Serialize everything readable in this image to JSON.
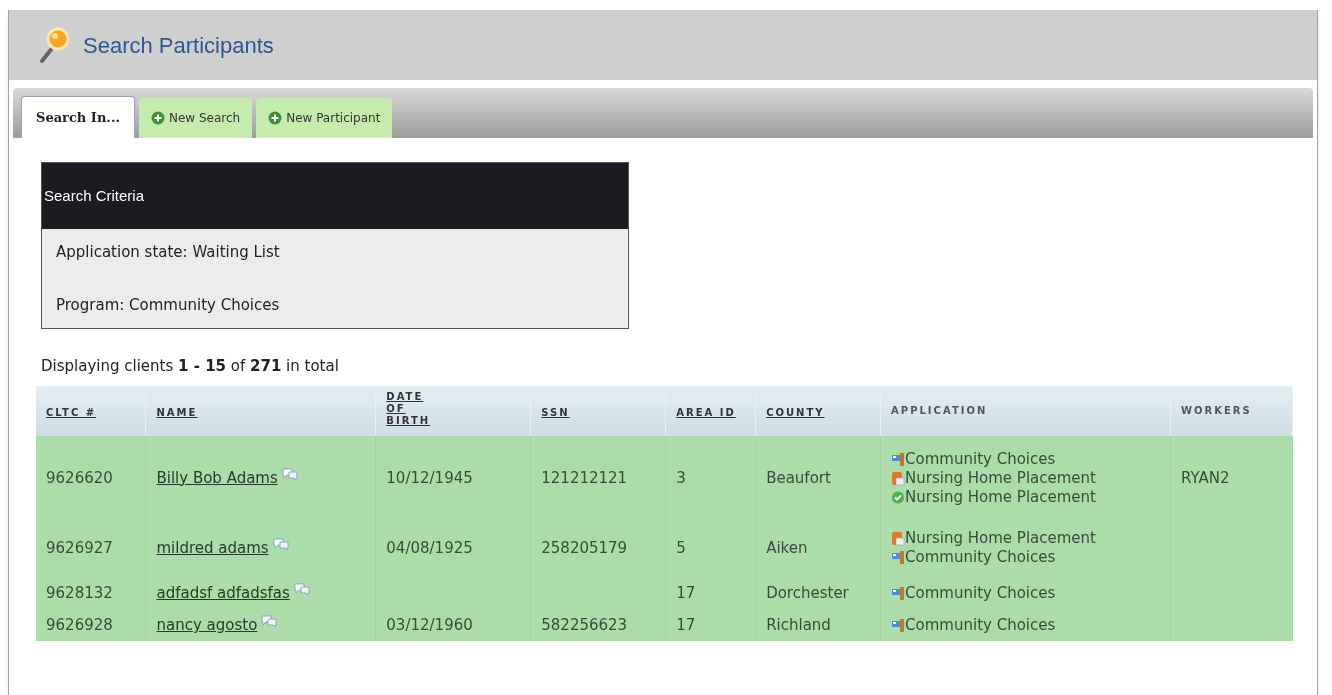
{
  "header": {
    "title": "Search Participants"
  },
  "tabs": [
    {
      "label": "Search In...",
      "kind": "plain",
      "selected": true
    },
    {
      "label": "New Search",
      "kind": "add",
      "selected": false
    },
    {
      "label": "New Participant",
      "kind": "add",
      "selected": false
    }
  ],
  "search_criteria": {
    "title": "Search Criteria",
    "lines": [
      "Application state: Waiting List",
      "Program: Community Choices"
    ]
  },
  "summary": "Displaying clients **1 - 15** of **271** in total",
  "table": {
    "columns": [
      {
        "label": "CLTC #",
        "sortable": true
      },
      {
        "label": "NAME",
        "sortable": true
      },
      {
        "label": "DATE OF BIRTH",
        "sortable": true
      },
      {
        "label": "SSN",
        "sortable": true
      },
      {
        "label": "AREA ID",
        "sortable": true
      },
      {
        "label": "COUNTY",
        "sortable": true
      },
      {
        "label": "APPLICATION",
        "sortable": false
      },
      {
        "label": "WORKERS",
        "sortable": false
      }
    ],
    "rows": [
      {
        "cltc": "9626620",
        "name": "Billy Bob Adams",
        "dob": "10/12/1945",
        "ssn": "121212121",
        "area_id": "3",
        "county": "Beaufort",
        "applications": [
          {
            "kind": "flag",
            "label": "Community Choices"
          },
          {
            "kind": "document",
            "label": "Nursing Home Placement"
          },
          {
            "kind": "approved",
            "label": "Nursing Home Placement"
          }
        ],
        "workers": "RYAN2"
      },
      {
        "cltc": "9626927",
        "name": "mildred adams",
        "dob": "04/08/1925",
        "ssn": "258205179",
        "area_id": "5",
        "county": "Aiken",
        "applications": [
          {
            "kind": "document",
            "label": "Nursing Home Placement"
          },
          {
            "kind": "flag",
            "label": "Community Choices"
          }
        ]
      },
      {
        "cltc": "9628132",
        "name": "adfadsf adfadsfas",
        "area_id": "17",
        "county": "Dorchester",
        "applications": [
          {
            "kind": "flag",
            "label": "Community Choices"
          }
        ]
      },
      {
        "cltc": "9626928",
        "name": "nancy agosto",
        "dob": "03/12/1960",
        "ssn": "582256623",
        "area_id": "17",
        "county": "Richland",
        "applications": [
          {
            "kind": "flag",
            "label": "Community Choices"
          }
        ]
      }
    ]
  }
}
